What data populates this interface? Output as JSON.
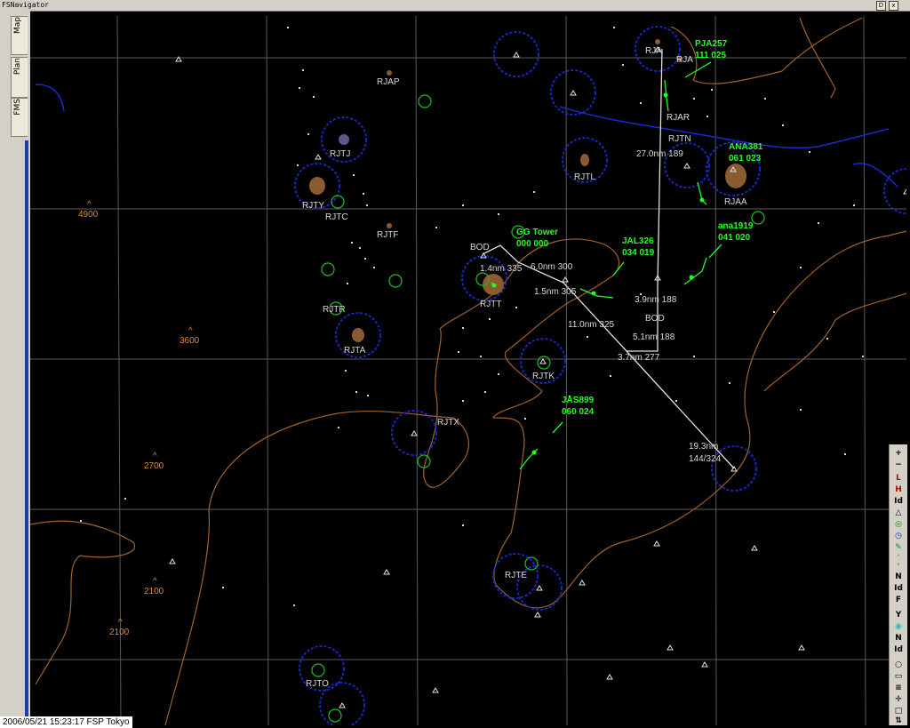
{
  "window": {
    "title": "FSNavigator",
    "btn_restore": "D",
    "btn_close": "x"
  },
  "tabs": [
    {
      "label": "Map"
    },
    {
      "label": "Plan"
    },
    {
      "label": "FMS"
    }
  ],
  "status": {
    "text": "2006/05/21 15:23:17 FSP Tokyo"
  },
  "colors": {
    "grid": "#5a5a5a",
    "coast": "#a0622a",
    "water": "#1a2ad0",
    "aircraft": "#20ff20",
    "route": "#e0e0e0",
    "elev": "#e08a30"
  },
  "airports": [
    {
      "id": "RJAP"
    },
    {
      "id": "RJTJ"
    },
    {
      "id": "RJTY"
    },
    {
      "id": "RJTC"
    },
    {
      "id": "RJTF"
    },
    {
      "id": "RJTR"
    },
    {
      "id": "RJTA"
    },
    {
      "id": "RJTT"
    },
    {
      "id": "RJTK"
    },
    {
      "id": "RJTX"
    },
    {
      "id": "RJTE"
    },
    {
      "id": "RJTO"
    },
    {
      "id": "RJTL"
    },
    {
      "id": "RJAR"
    },
    {
      "id": "RJTN"
    },
    {
      "id": "RJAA"
    },
    {
      "id": "RJA"
    },
    {
      "id": "RJA"
    }
  ],
  "elevations": [
    {
      "ft": "4900"
    },
    {
      "ft": "3600"
    },
    {
      "ft": "2700"
    },
    {
      "ft": "2100"
    },
    {
      "ft": "2100"
    }
  ],
  "route_labels": [
    {
      "text": "BOD"
    },
    {
      "text": "1.4nm 335"
    },
    {
      "text": "6.0nm 300"
    },
    {
      "text": "1.5nm 305"
    },
    {
      "text": "11.0nm 325"
    },
    {
      "text": "3.9nm 188"
    },
    {
      "text": "BOD"
    },
    {
      "text": "5.1nm 188"
    },
    {
      "text": "3.7nm 277"
    },
    {
      "text": "27.0nm 189"
    },
    {
      "text": "19.3nm"
    },
    {
      "text": "144/324"
    }
  ],
  "aircraft": [
    {
      "callsign": "PJA257",
      "data": "111  025"
    },
    {
      "callsign": "ANA381",
      "data": "061  023"
    },
    {
      "callsign": "ana1919",
      "data": "041  020"
    },
    {
      "callsign": "JAL326",
      "data": "034  019"
    },
    {
      "callsign": "GG Tower",
      "data": "000  000"
    },
    {
      "callsign": "JAS899",
      "data": "060  024"
    }
  ],
  "tools": [
    {
      "label": "+"
    },
    {
      "label": "−"
    },
    {
      "label": "L"
    },
    {
      "label": "H"
    },
    {
      "label": "Id"
    },
    {
      "label": "△"
    },
    {
      "label": "◎"
    },
    {
      "label": "◷"
    },
    {
      "label": "✎"
    },
    {
      "label": "·"
    },
    {
      "label": "·"
    },
    {
      "label": "N"
    },
    {
      "label": "Id"
    },
    {
      "label": "F"
    },
    {
      "label": "Y"
    },
    {
      "label": "◉"
    },
    {
      "label": "N"
    },
    {
      "label": "Id"
    },
    {
      "label": "○"
    },
    {
      "label": "▭"
    },
    {
      "label": "≡"
    },
    {
      "label": "✛"
    },
    {
      "label": "□"
    },
    {
      "label": "⇅"
    }
  ]
}
